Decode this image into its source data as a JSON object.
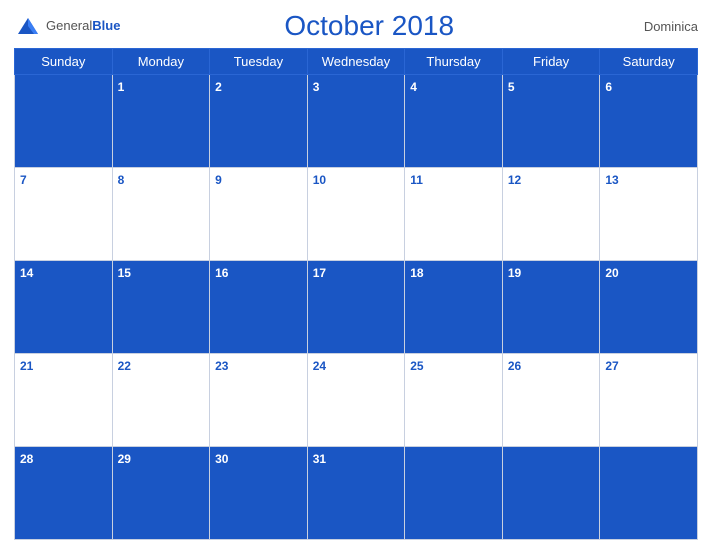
{
  "header": {
    "logo_general": "General",
    "logo_blue": "Blue",
    "title": "October 2018",
    "country": "Dominica"
  },
  "days_of_week": [
    "Sunday",
    "Monday",
    "Tuesday",
    "Wednesday",
    "Thursday",
    "Friday",
    "Saturday"
  ],
  "weeks": [
    {
      "style": "blue",
      "days": [
        {
          "num": "",
          "empty": true
        },
        {
          "num": "1"
        },
        {
          "num": "2"
        },
        {
          "num": "3"
        },
        {
          "num": "4"
        },
        {
          "num": "5"
        },
        {
          "num": "6"
        }
      ]
    },
    {
      "style": "white",
      "days": [
        {
          "num": "7"
        },
        {
          "num": "8"
        },
        {
          "num": "9"
        },
        {
          "num": "10"
        },
        {
          "num": "11"
        },
        {
          "num": "12"
        },
        {
          "num": "13"
        }
      ]
    },
    {
      "style": "blue",
      "days": [
        {
          "num": "14"
        },
        {
          "num": "15"
        },
        {
          "num": "16"
        },
        {
          "num": "17"
        },
        {
          "num": "18"
        },
        {
          "num": "19"
        },
        {
          "num": "20"
        }
      ]
    },
    {
      "style": "white",
      "days": [
        {
          "num": "21"
        },
        {
          "num": "22"
        },
        {
          "num": "23"
        },
        {
          "num": "24"
        },
        {
          "num": "25"
        },
        {
          "num": "26"
        },
        {
          "num": "27"
        }
      ]
    },
    {
      "style": "blue",
      "days": [
        {
          "num": "28"
        },
        {
          "num": "29"
        },
        {
          "num": "30"
        },
        {
          "num": "31"
        },
        {
          "num": ""
        },
        {
          "num": ""
        },
        {
          "num": ""
        }
      ]
    }
  ],
  "colors": {
    "blue": "#1a56c4",
    "white": "#ffffff",
    "border": "#c8d0e0",
    "text_gray": "#555555"
  }
}
